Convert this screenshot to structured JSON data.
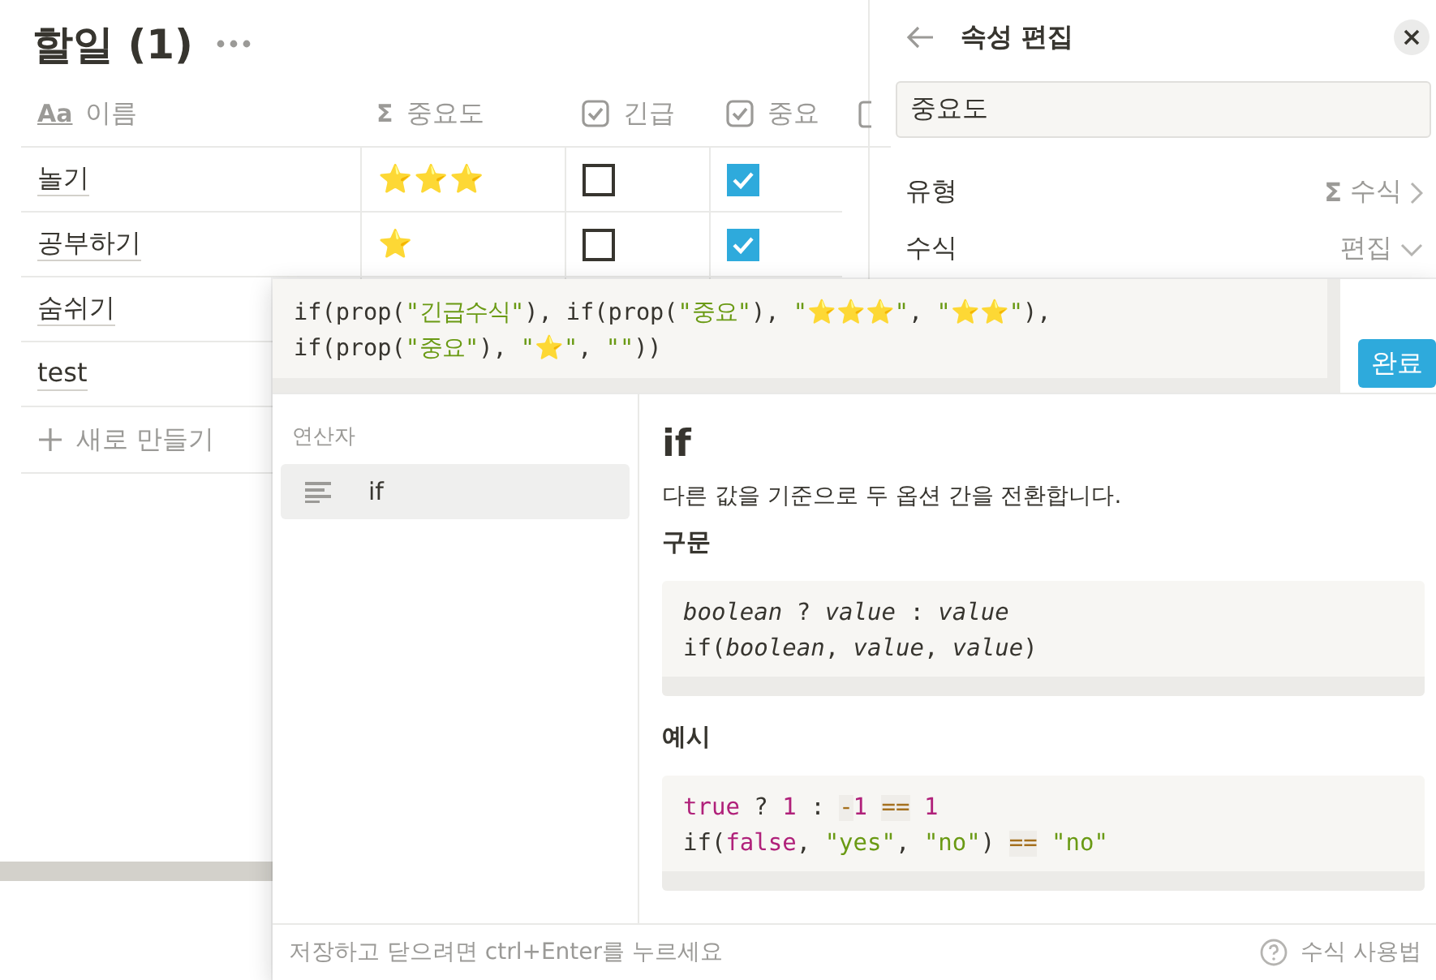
{
  "page": {
    "title": "할일 (1)"
  },
  "table": {
    "columns": [
      {
        "kind": "title",
        "icon": "Aa",
        "label": "이름"
      },
      {
        "kind": "formula",
        "icon": "Σ",
        "label": "중요도"
      },
      {
        "kind": "checkbox",
        "label": "긴급"
      },
      {
        "kind": "checkbox",
        "label": "중요"
      }
    ],
    "rows": [
      {
        "name": "놀기",
        "importance": "⭐⭐⭐",
        "urgent": false,
        "important": true
      },
      {
        "name": "공부하기",
        "importance": "⭐",
        "urgent": false,
        "important": true
      },
      {
        "name": "숨쉬기"
      },
      {
        "name": "test"
      }
    ],
    "new_row": "새로 만들기"
  },
  "property_panel": {
    "title": "속성 편집",
    "name_value": "중요도",
    "rows": [
      {
        "kind": "type",
        "label": "유형",
        "icon": "Σ",
        "value": "수식"
      },
      {
        "kind": "formula",
        "label": "수식",
        "value": "편집"
      }
    ]
  },
  "formula_editor": {
    "lines": [
      [
        {
          "kind": "text",
          "text": "if(prop("
        },
        {
          "kind": "string",
          "text": "\"긴급수식\""
        },
        {
          "kind": "text",
          "text": "), if(prop("
        },
        {
          "kind": "string",
          "text": "\"중요\""
        },
        {
          "kind": "text",
          "text": "), "
        },
        {
          "kind": "string",
          "text": "\"⭐⭐⭐\""
        },
        {
          "kind": "text",
          "text": ", "
        },
        {
          "kind": "string",
          "text": "\"⭐⭐\""
        },
        {
          "kind": "text",
          "text": "),"
        }
      ],
      [
        {
          "kind": "text",
          "text": "if(prop("
        },
        {
          "kind": "string",
          "text": "\"중요\""
        },
        {
          "kind": "text",
          "text": "), "
        },
        {
          "kind": "string",
          "text": "\"⭐\""
        },
        {
          "kind": "text",
          "text": ", "
        },
        {
          "kind": "string",
          "text": "\"\""
        },
        {
          "kind": "text",
          "text": "))"
        }
      ]
    ],
    "done": "완료"
  },
  "functions": {
    "section": "연산자",
    "items": [
      {
        "label": "if",
        "selected": true
      }
    ]
  },
  "docs": {
    "title": "if",
    "description": "다른 값을 기준으로 두 옵션 간을 전환합니다.",
    "syntax_heading": "구문",
    "syntax": [
      [
        {
          "kind": "param",
          "text": "boolean"
        },
        {
          "kind": "text",
          "text": " ? "
        },
        {
          "kind": "param",
          "text": "value"
        },
        {
          "kind": "text",
          "text": " : "
        },
        {
          "kind": "param",
          "text": "value"
        }
      ],
      [
        {
          "kind": "text",
          "text": "if("
        },
        {
          "kind": "param",
          "text": "boolean"
        },
        {
          "kind": "text",
          "text": ", "
        },
        {
          "kind": "param",
          "text": "value"
        },
        {
          "kind": "text",
          "text": ", "
        },
        {
          "kind": "param",
          "text": "value"
        },
        {
          "kind": "text",
          "text": ")"
        }
      ]
    ],
    "example_heading": "예시",
    "example": [
      [
        {
          "kind": "keyword",
          "text": "true"
        },
        {
          "kind": "text",
          "text": " ? "
        },
        {
          "kind": "number",
          "text": "1"
        },
        {
          "kind": "text",
          "text": " : "
        },
        {
          "kind": "operator",
          "text": "-"
        },
        {
          "kind": "number",
          "text": "1 "
        },
        {
          "kind": "operator",
          "text": "=="
        },
        {
          "kind": "number",
          "text": " 1"
        }
      ],
      [
        {
          "kind": "text",
          "text": "if("
        },
        {
          "kind": "keyword",
          "text": "false"
        },
        {
          "kind": "text",
          "text": ", "
        },
        {
          "kind": "string",
          "text": "\"yes\""
        },
        {
          "kind": "text",
          "text": ", "
        },
        {
          "kind": "string",
          "text": "\"no\""
        },
        {
          "kind": "text",
          "text": ") "
        },
        {
          "kind": "operator",
          "text": "=="
        },
        {
          "kind": "string",
          "text": " \"no\""
        }
      ]
    ]
  },
  "footer": {
    "hint": "저장하고 닫으려면 ctrl+Enter를 누르세요",
    "help": "수식 사용법"
  }
}
